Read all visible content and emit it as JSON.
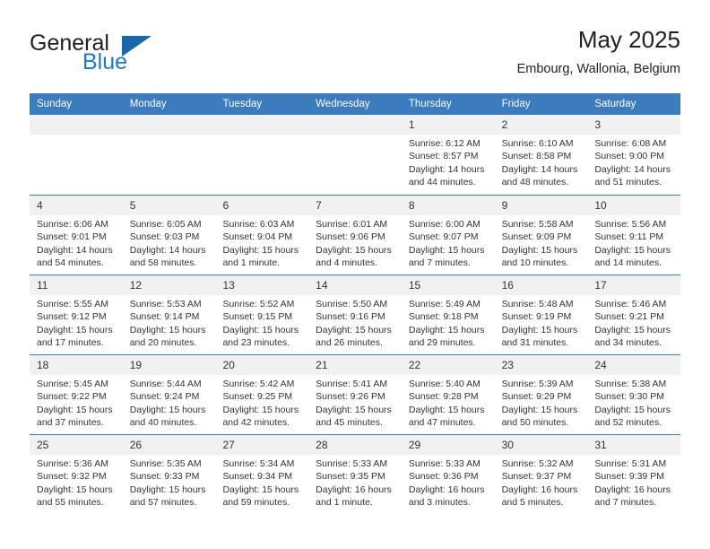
{
  "logo": {
    "word_one": "General",
    "word_two": "Blue",
    "triangle_color": "#1767ab",
    "blue_color": "#1f7ac4"
  },
  "header": {
    "title": "May 2025",
    "subtitle": "Embourg, Wallonia, Belgium"
  },
  "theme": {
    "header_blue": "#3a7cbe",
    "date_band": "#f1f1f1"
  },
  "weekdays": [
    "Sunday",
    "Monday",
    "Tuesday",
    "Wednesday",
    "Thursday",
    "Friday",
    "Saturday"
  ],
  "weeks": [
    [
      {
        "day": "",
        "empty": true
      },
      {
        "day": "",
        "empty": true
      },
      {
        "day": "",
        "empty": true
      },
      {
        "day": "",
        "empty": true
      },
      {
        "day": "1",
        "sunrise": "Sunrise: 6:12 AM",
        "sunset": "Sunset: 8:57 PM",
        "daylight": "Daylight: 14 hours and 44 minutes."
      },
      {
        "day": "2",
        "sunrise": "Sunrise: 6:10 AM",
        "sunset": "Sunset: 8:58 PM",
        "daylight": "Daylight: 14 hours and 48 minutes."
      },
      {
        "day": "3",
        "sunrise": "Sunrise: 6:08 AM",
        "sunset": "Sunset: 9:00 PM",
        "daylight": "Daylight: 14 hours and 51 minutes."
      }
    ],
    [
      {
        "day": "4",
        "sunrise": "Sunrise: 6:06 AM",
        "sunset": "Sunset: 9:01 PM",
        "daylight": "Daylight: 14 hours and 54 minutes."
      },
      {
        "day": "5",
        "sunrise": "Sunrise: 6:05 AM",
        "sunset": "Sunset: 9:03 PM",
        "daylight": "Daylight: 14 hours and 58 minutes."
      },
      {
        "day": "6",
        "sunrise": "Sunrise: 6:03 AM",
        "sunset": "Sunset: 9:04 PM",
        "daylight": "Daylight: 15 hours and 1 minute."
      },
      {
        "day": "7",
        "sunrise": "Sunrise: 6:01 AM",
        "sunset": "Sunset: 9:06 PM",
        "daylight": "Daylight: 15 hours and 4 minutes."
      },
      {
        "day": "8",
        "sunrise": "Sunrise: 6:00 AM",
        "sunset": "Sunset: 9:07 PM",
        "daylight": "Daylight: 15 hours and 7 minutes."
      },
      {
        "day": "9",
        "sunrise": "Sunrise: 5:58 AM",
        "sunset": "Sunset: 9:09 PM",
        "daylight": "Daylight: 15 hours and 10 minutes."
      },
      {
        "day": "10",
        "sunrise": "Sunrise: 5:56 AM",
        "sunset": "Sunset: 9:11 PM",
        "daylight": "Daylight: 15 hours and 14 minutes."
      }
    ],
    [
      {
        "day": "11",
        "sunrise": "Sunrise: 5:55 AM",
        "sunset": "Sunset: 9:12 PM",
        "daylight": "Daylight: 15 hours and 17 minutes."
      },
      {
        "day": "12",
        "sunrise": "Sunrise: 5:53 AM",
        "sunset": "Sunset: 9:14 PM",
        "daylight": "Daylight: 15 hours and 20 minutes."
      },
      {
        "day": "13",
        "sunrise": "Sunrise: 5:52 AM",
        "sunset": "Sunset: 9:15 PM",
        "daylight": "Daylight: 15 hours and 23 minutes."
      },
      {
        "day": "14",
        "sunrise": "Sunrise: 5:50 AM",
        "sunset": "Sunset: 9:16 PM",
        "daylight": "Daylight: 15 hours and 26 minutes."
      },
      {
        "day": "15",
        "sunrise": "Sunrise: 5:49 AM",
        "sunset": "Sunset: 9:18 PM",
        "daylight": "Daylight: 15 hours and 29 minutes."
      },
      {
        "day": "16",
        "sunrise": "Sunrise: 5:48 AM",
        "sunset": "Sunset: 9:19 PM",
        "daylight": "Daylight: 15 hours and 31 minutes."
      },
      {
        "day": "17",
        "sunrise": "Sunrise: 5:46 AM",
        "sunset": "Sunset: 9:21 PM",
        "daylight": "Daylight: 15 hours and 34 minutes."
      }
    ],
    [
      {
        "day": "18",
        "sunrise": "Sunrise: 5:45 AM",
        "sunset": "Sunset: 9:22 PM",
        "daylight": "Daylight: 15 hours and 37 minutes."
      },
      {
        "day": "19",
        "sunrise": "Sunrise: 5:44 AM",
        "sunset": "Sunset: 9:24 PM",
        "daylight": "Daylight: 15 hours and 40 minutes."
      },
      {
        "day": "20",
        "sunrise": "Sunrise: 5:42 AM",
        "sunset": "Sunset: 9:25 PM",
        "daylight": "Daylight: 15 hours and 42 minutes."
      },
      {
        "day": "21",
        "sunrise": "Sunrise: 5:41 AM",
        "sunset": "Sunset: 9:26 PM",
        "daylight": "Daylight: 15 hours and 45 minutes."
      },
      {
        "day": "22",
        "sunrise": "Sunrise: 5:40 AM",
        "sunset": "Sunset: 9:28 PM",
        "daylight": "Daylight: 15 hours and 47 minutes."
      },
      {
        "day": "23",
        "sunrise": "Sunrise: 5:39 AM",
        "sunset": "Sunset: 9:29 PM",
        "daylight": "Daylight: 15 hours and 50 minutes."
      },
      {
        "day": "24",
        "sunrise": "Sunrise: 5:38 AM",
        "sunset": "Sunset: 9:30 PM",
        "daylight": "Daylight: 15 hours and 52 minutes."
      }
    ],
    [
      {
        "day": "25",
        "sunrise": "Sunrise: 5:36 AM",
        "sunset": "Sunset: 9:32 PM",
        "daylight": "Daylight: 15 hours and 55 minutes."
      },
      {
        "day": "26",
        "sunrise": "Sunrise: 5:35 AM",
        "sunset": "Sunset: 9:33 PM",
        "daylight": "Daylight: 15 hours and 57 minutes."
      },
      {
        "day": "27",
        "sunrise": "Sunrise: 5:34 AM",
        "sunset": "Sunset: 9:34 PM",
        "daylight": "Daylight: 15 hours and 59 minutes."
      },
      {
        "day": "28",
        "sunrise": "Sunrise: 5:33 AM",
        "sunset": "Sunset: 9:35 PM",
        "daylight": "Daylight: 16 hours and 1 minute."
      },
      {
        "day": "29",
        "sunrise": "Sunrise: 5:33 AM",
        "sunset": "Sunset: 9:36 PM",
        "daylight": "Daylight: 16 hours and 3 minutes."
      },
      {
        "day": "30",
        "sunrise": "Sunrise: 5:32 AM",
        "sunset": "Sunset: 9:37 PM",
        "daylight": "Daylight: 16 hours and 5 minutes."
      },
      {
        "day": "31",
        "sunrise": "Sunrise: 5:31 AM",
        "sunset": "Sunset: 9:39 PM",
        "daylight": "Daylight: 16 hours and 7 minutes."
      }
    ]
  ]
}
